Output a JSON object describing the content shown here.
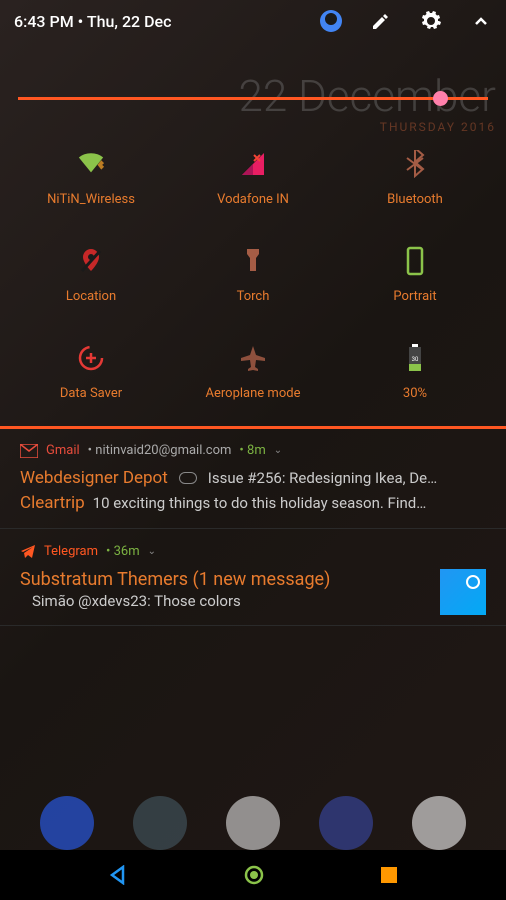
{
  "status": {
    "time_date": "6:43 PM  •  Thu, 22 Dec"
  },
  "background": {
    "date": "22 December",
    "day": "THURSDAY 2016"
  },
  "slider": {
    "position": 89
  },
  "tiles": [
    {
      "id": "wifi",
      "label": "NiTiN_Wireless",
      "icon": "wifi-icon",
      "color_a": "#8bc34a",
      "color_b": "#ffa726"
    },
    {
      "id": "cell",
      "label": "Vodafone IN",
      "icon": "signal-icon",
      "color_a": "#ad1457",
      "color_b": "#e91e63"
    },
    {
      "id": "bt",
      "label": "Bluetooth",
      "icon": "bluetooth-icon",
      "color_a": "#ff8a65"
    },
    {
      "id": "loc",
      "label": "Location",
      "icon": "location-icon",
      "color_a": "#c62828"
    },
    {
      "id": "torch",
      "label": "Torch",
      "icon": "torch-icon",
      "color_a": "#ff8a65"
    },
    {
      "id": "rot",
      "label": "Portrait",
      "icon": "portrait-icon",
      "color_a": "#8bc34a"
    },
    {
      "id": "ds",
      "label": "Data Saver",
      "icon": "data-saver-icon",
      "color_a": "#e53935"
    },
    {
      "id": "air",
      "label": "Aeroplane mode",
      "icon": "airplane-icon",
      "color_a": "#ff8a65"
    },
    {
      "id": "bat",
      "label": "30%",
      "icon": "battery-icon",
      "color_a": "#8bc34a",
      "color_b": "#fff"
    }
  ],
  "notifications": [
    {
      "app": "Gmail",
      "app_color": "#e74c3c",
      "sub": "nitinvaid20@gmail.com",
      "time": "8m",
      "items": [
        {
          "sender": "Webdesigner Depot",
          "text": "Issue #256: Redesigning Ikea, De…",
          "attach": true
        },
        {
          "sender": "Cleartrip",
          "text": "10 exciting things to do this holiday season. Find…"
        }
      ]
    },
    {
      "app": "Telegram",
      "app_color": "#ff5722",
      "time": "36m",
      "title": "Substratum Themers (1 new message)",
      "detail": "Simão @xdevs23: Those colors",
      "thumb": true
    }
  ],
  "icons": {
    "edit": "edit-icon",
    "settings": "gear-icon",
    "expand": "chevron-up-icon",
    "avatar": "avatar-icon"
  },
  "nav": {
    "back": "back-icon",
    "home": "home-icon",
    "recent": "recent-icon"
  }
}
